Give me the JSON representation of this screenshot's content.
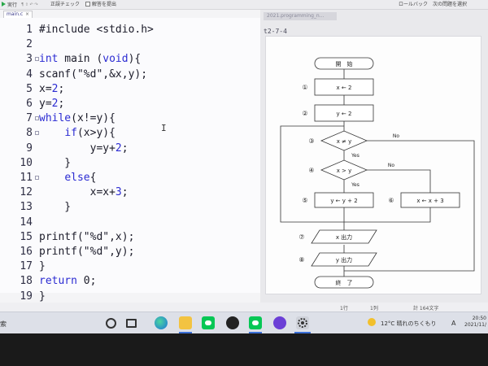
{
  "toolbar": {
    "run_label": "実行",
    "check_label": "正誤チェック",
    "submit_label": "解答を提出",
    "rollback_label": "ロールバック",
    "next_label": "次の問題を選択"
  },
  "editor": {
    "tab_label": "main.c",
    "tab_close": "×",
    "cursor": "I",
    "lines": [
      {
        "n": "1",
        "text": "#include <stdio.h>"
      },
      {
        "n": "2",
        "text": ""
      },
      {
        "n": "3",
        "text": "int main (void){"
      },
      {
        "n": "4",
        "text": "scanf(\"%d\",&x,y);"
      },
      {
        "n": "5",
        "text": "x=2;"
      },
      {
        "n": "6",
        "text": "y=2;"
      },
      {
        "n": "7",
        "text": "while(x!=y){"
      },
      {
        "n": "8",
        "text": "    if(x>y){"
      },
      {
        "n": "9",
        "text": "        y=y+2;"
      },
      {
        "n": "10",
        "text": "    }"
      },
      {
        "n": "11",
        "text": "    else{"
      },
      {
        "n": "12",
        "text": "        x=x+3;"
      },
      {
        "n": "13",
        "text": "    }"
      },
      {
        "n": "14",
        "text": ""
      },
      {
        "n": "15",
        "text": "printf(\"%d\",x);"
      },
      {
        "n": "16",
        "text": "printf(\"%d\",y);"
      },
      {
        "n": "17",
        "text": "}"
      },
      {
        "n": "18",
        "text": "return 0;"
      },
      {
        "n": "19",
        "text": "}"
      }
    ]
  },
  "viewer": {
    "title": "2021.programming_n...",
    "problem_tag": "t2-7-4"
  },
  "flowchart": {
    "start": "開　始",
    "end": "終　了",
    "steps": [
      {
        "no": "①",
        "label": "x ← 2"
      },
      {
        "no": "②",
        "label": "y ← 2"
      },
      {
        "no": "③",
        "label": "x ≠ y"
      },
      {
        "no": "④",
        "label": "x > y"
      },
      {
        "no": "⑤",
        "label": "y ← y + 2"
      },
      {
        "no": "⑥",
        "label": "x ← x + 3"
      },
      {
        "no": "⑦",
        "label": "x 出力"
      },
      {
        "no": "⑧",
        "label": "y 出力"
      }
    ],
    "yes": "Yes",
    "no": "No"
  },
  "statusbar": {
    "line": "1行",
    "col": "1列",
    "count": "計 164文字"
  },
  "taskbar": {
    "search_label": "索",
    "weather": "12°C  晴れのちくもり",
    "time": "20:50",
    "date": "2021/11/",
    "ime": "A"
  },
  "colors": {
    "keyword": "#2b2bd2",
    "line_app": "#06c755",
    "taskbar": "#dde0e8"
  }
}
